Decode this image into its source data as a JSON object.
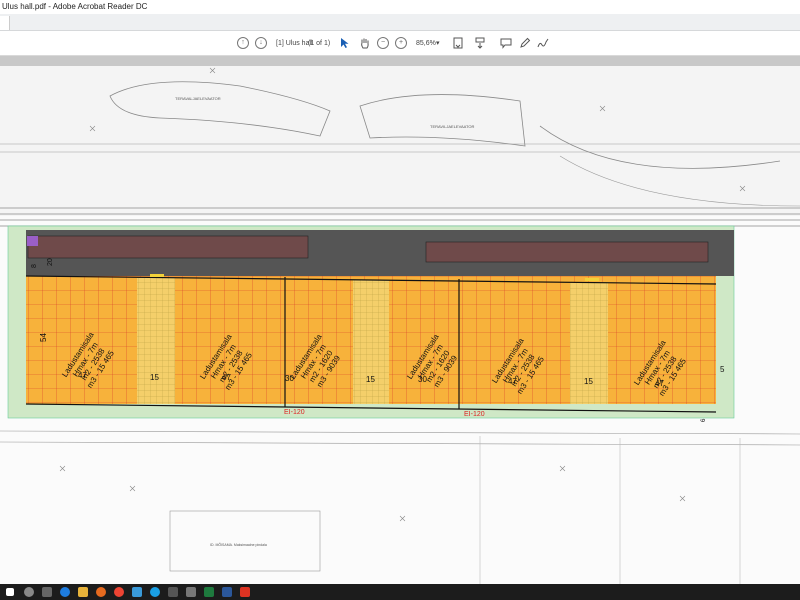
{
  "window": {
    "title": "Ulus hall.pdf - Adobe Acrobat Reader DC"
  },
  "toolbar": {
    "page_label": "[1] Ulus hall",
    "page_count": "(1 of 1)",
    "zoom": "85,6%"
  },
  "map": {
    "road_label_1": "TERAVALJAELEVAATOR",
    "road_label_2": "TERAVILJAELEVAATOR",
    "fire_label": "EI-120",
    "building_label": "Laduistamisala",
    "block_label": "ID. MÕISAMA. Maksimaalne pindala",
    "dim_left_height": "54",
    "dim_small_8": "8",
    "dim_small_20": "20",
    "dim_right": "5",
    "dim_bottom_right": "6",
    "zones": [
      {
        "line1": "Ladustamisala",
        "line2": "Hmax - 7m",
        "line3": "m2 - 2538",
        "line4": "m3 - 15 465",
        "width_label": "47"
      },
      {
        "line1": "Ladustamisala",
        "line2": "Hmax - 7m",
        "line3": "m2 - 2538",
        "line4": "m3 - 15 465",
        "width_label": "47"
      },
      {
        "line1": "Ladustamisala",
        "line2": "Hmax - 7m",
        "line3": "m2 - 1620",
        "line4": "m3 - 9039",
        "width_label": "30"
      },
      {
        "line1": "Ladustamisala",
        "line2": "Hmax - 7m",
        "line3": "m2 - 1620",
        "line4": "m3 - 9039",
        "width_label": "30"
      },
      {
        "line1": "Ladustamisala",
        "line2": "Hmax - 7m",
        "line3": "m2 - 2538",
        "line4": "m3 - 15 465",
        "width_label": "47"
      },
      {
        "line1": "Ladustamisala",
        "line2": "Hmax - 7m",
        "line3": "m2 - 2538",
        "line4": "m3 - 15 465",
        "width_label": "47"
      }
    ],
    "corridor_labels": [
      "15",
      "15",
      "15"
    ]
  }
}
